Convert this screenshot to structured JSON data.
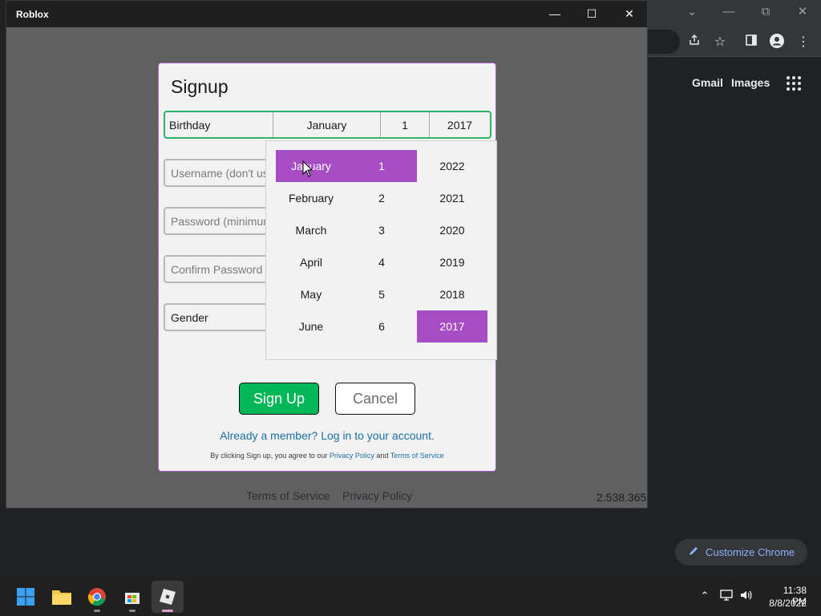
{
  "chrome": {
    "gmail": "Gmail",
    "images": "Images",
    "customize": "Customize Chrome"
  },
  "roblox": {
    "title": "Roblox",
    "footer_tos": "Terms of Service",
    "footer_privacy": "Privacy Policy",
    "version": "2.538.365"
  },
  "signup": {
    "title": "Signup",
    "birthday": {
      "label": "Birthday",
      "month": "January",
      "day": "1",
      "year": "2017"
    },
    "username_placeholder": "Username (don't us",
    "password_placeholder": "Password (minimum",
    "confirm_placeholder": "Confirm Password",
    "gender_label": "Gender",
    "signup_button": "Sign Up",
    "cancel_button": "Cancel",
    "login_link": "Already a member? Log in to your account.",
    "terms_prefix": "By clicking Sign up, you agree to our ",
    "terms_privacy": "Privacy Policy",
    "terms_and": " and ",
    "terms_tos": "Terms of Service"
  },
  "date_picker": {
    "months": [
      "January",
      "February",
      "March",
      "April",
      "May",
      "June"
    ],
    "days": [
      "1",
      "2",
      "3",
      "4",
      "5",
      "6"
    ],
    "years": [
      "2022",
      "2021",
      "2020",
      "2019",
      "2018",
      "2017"
    ],
    "selected_month": "January",
    "selected_day": "1",
    "selected_year": "2017"
  },
  "taskbar": {
    "time": "11:38 PM",
    "date": "8/8/2022"
  },
  "colors": {
    "accent_purple": "#a64dc3",
    "signup_green": "#02b757",
    "link_blue": "#1c6fa3"
  }
}
